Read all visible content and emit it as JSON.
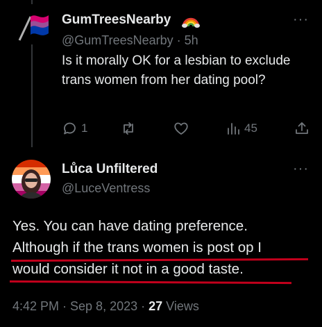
{
  "post1": {
    "display_name": "GumTreesNearby",
    "handle_time": "@GumTreesNearby · 5h",
    "text": "Is it morally OK for a lesbian to exclude trans women from her dating pool?",
    "actions": {
      "reply_count": "1",
      "retweet_count": "",
      "like_count": "",
      "views_count": "45"
    },
    "more": "···"
  },
  "post2": {
    "display_name": "Lůca Unfiltered",
    "handle": "@LuceVentress",
    "text_lines": [
      "Yes. You can have dating preference.",
      "Although if the trans women is post op I",
      "would consider it not in a good taste."
    ],
    "timestamp": "4:42 PM · Sep 8, 2023 · ",
    "views_count": "27",
    "views_label": " Views",
    "more": "···"
  },
  "colors": {
    "background": "#000000",
    "text": "#e7e9ea",
    "muted": "#71767b",
    "annotation_red": "#c3001c",
    "thread_line": "#333639"
  }
}
